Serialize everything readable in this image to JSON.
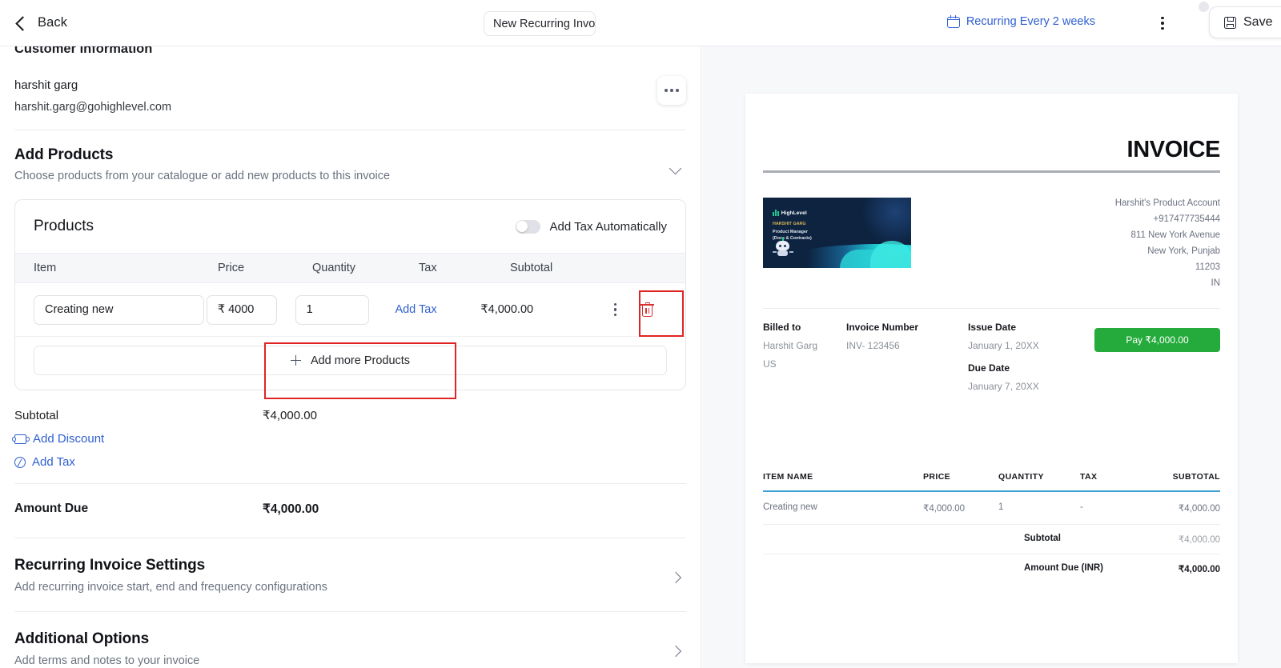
{
  "topbar": {
    "back_label": "Back",
    "title_value": "New Recurring Invoice",
    "recurring_label": "Recurring Every 2 weeks",
    "save_label": "Save"
  },
  "customer": {
    "section_title": "Customer Information",
    "name": "harshit garg",
    "email": "harshit.garg@gohighlevel.com"
  },
  "add_products": {
    "title": "Add Products",
    "subtitle": "Choose products from your catalogue or add new products to this invoice"
  },
  "products": {
    "card_title": "Products",
    "tax_toggle_label": "Add Tax Automatically",
    "tax_toggle_on": false,
    "columns": [
      "Item",
      "Price",
      "Quantity",
      "Tax",
      "Subtotal"
    ],
    "rows": [
      {
        "item": "Creating new",
        "price": "₹ 4000",
        "quantity": "1",
        "tax_link": "Add Tax",
        "subtotal": "₹4,000.00"
      }
    ],
    "add_more_label": "Add more Products"
  },
  "totals": {
    "subtotal_label": "Subtotal",
    "subtotal_value": "₹4,000.00",
    "add_discount_label": "Add Discount",
    "add_tax_label": "Add Tax",
    "amount_due_label": "Amount Due",
    "amount_due_value": "₹4,000.00"
  },
  "sections": [
    {
      "title": "Recurring Invoice Settings",
      "subtitle": "Add recurring invoice start, end and frequency configurations"
    },
    {
      "title": "Additional Options",
      "subtitle": "Add terms and notes to your invoice"
    }
  ],
  "preview": {
    "heading": "INVOICE",
    "logo": {
      "brand": "HighLevel",
      "person": "HARSHIT GARG",
      "role_line1": "Product Manager",
      "role_line2": "(Docs & Contracts)"
    },
    "from": [
      "Harshit's Product Account",
      "+917477735444",
      "811 New York Avenue",
      "New York, Punjab",
      "11203",
      "IN"
    ],
    "billed_to_label": "Billed to",
    "billed_to_name": "Harshit Garg",
    "billed_to_country": "US",
    "invoice_number_label": "Invoice Number",
    "invoice_number_value": "INV- 123456",
    "issue_date_label": "Issue Date",
    "issue_date_value": "January 1, 20XX",
    "due_date_label": "Due Date",
    "due_date_value": "January 7, 20XX",
    "pay_button": "Pay ₹4,000.00",
    "table_columns": [
      "ITEM NAME",
      "PRICE",
      "QUANTITY",
      "TAX",
      "SUBTOTAL"
    ],
    "table_rows": [
      {
        "name": "Creating new",
        "price": "₹4,000.00",
        "quantity": "1",
        "tax": "-",
        "subtotal": "₹4,000.00"
      }
    ],
    "summary": [
      {
        "label": "Subtotal",
        "value": "₹4,000.00"
      },
      {
        "label": "Amount Due (INR)",
        "value": "₹4,000.00"
      }
    ]
  },
  "colors": {
    "link_blue": "#2f5fd0",
    "danger_red": "#e02424",
    "pay_green": "#25ab3c",
    "table_rule_blue": "#3f9fd6"
  }
}
